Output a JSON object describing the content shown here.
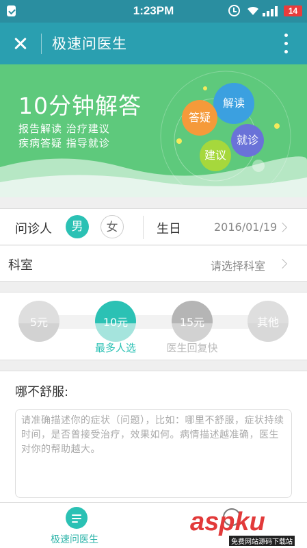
{
  "status_bar": {
    "time": "1:23PM",
    "battery": "14"
  },
  "header": {
    "title": "极速问医生",
    "close_icon": "close-icon",
    "more_icon": "more-vert-icon"
  },
  "banner": {
    "title": "10分钟解答",
    "line1": "报告解读  治疗建议",
    "line2": "疾病答疑  指导就诊",
    "bubbles": [
      "解读",
      "答疑",
      "就诊",
      "建议"
    ]
  },
  "visitor": {
    "label": "问诊人",
    "male": "男",
    "female": "女",
    "birthday_label": "生日",
    "birthday_value": "2016/01/19"
  },
  "department": {
    "label": "科室",
    "value": "请选择科室"
  },
  "price": {
    "options": [
      {
        "label": "5元",
        "sub": ""
      },
      {
        "label": "10元",
        "sub": "最多人选"
      },
      {
        "label": "15元",
        "sub": "医生回复快"
      },
      {
        "label": "其他",
        "sub": ""
      }
    ],
    "selected_index": 1
  },
  "complaint": {
    "title": "哪不舒服:",
    "placeholder": "请准确描述你的症状（问题），比如：哪里不舒服，症状持续时间，是否曾接受治疗，效果如何。病情描述越准确，医生对你的帮助越大。"
  },
  "bottom_bar": {
    "tab1_label": "极速问医生"
  },
  "watermark": {
    "text": "aspku",
    "sub": "免费网站源码下载站"
  },
  "colors": {
    "primary": "#2a9fb0",
    "accent": "#2bc1b4",
    "banner": "#5ec97c"
  }
}
